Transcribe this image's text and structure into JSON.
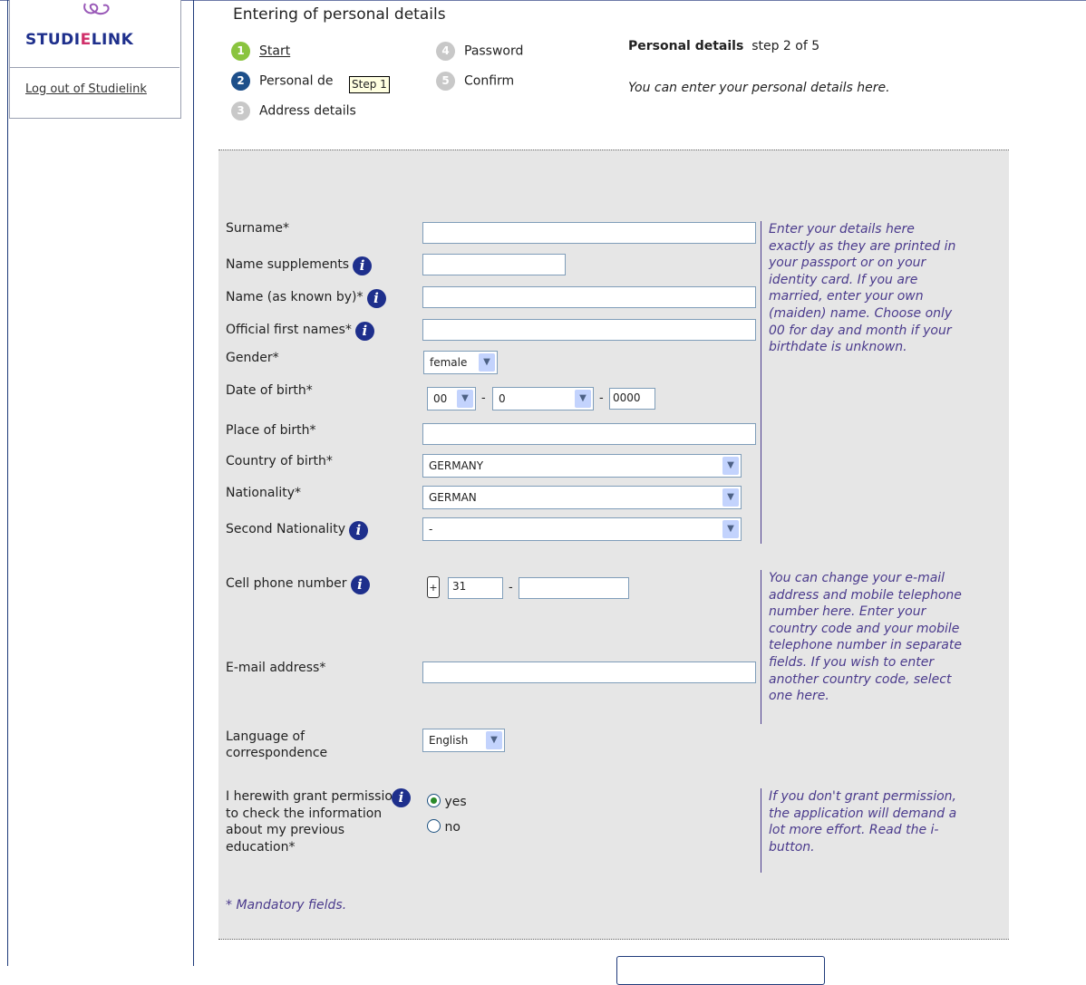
{
  "sidebar": {
    "logo": "STUDIELINK",
    "logout": "Log out of Studielink"
  },
  "header": {
    "title": "Entering of personal details",
    "steps": [
      {
        "num": "1",
        "label": "Start"
      },
      {
        "num": "2",
        "label": "Personal de"
      },
      {
        "num": "3",
        "label": "Address details"
      },
      {
        "num": "4",
        "label": "Password"
      },
      {
        "num": "5",
        "label": "Confirm"
      }
    ],
    "tooltip": "Step 1",
    "right_title_bold": "Personal details",
    "right_title_step": "step 2 of 5",
    "right_desc": "You can enter your personal details here."
  },
  "form": {
    "labels": {
      "surname": "Surname*",
      "name_supplements": "Name supplements",
      "known_by": "Name (as known by)*",
      "first_names": "Official first names*",
      "gender": "Gender*",
      "dob": "Date of birth*",
      "place_of_birth": "Place of birth*",
      "country_of_birth": "Country of birth*",
      "nationality": "Nationality*",
      "second_nationality": "Second Nationality",
      "cell_phone": "Cell phone number",
      "email": "E-mail address*",
      "language": "Language of correspondence",
      "permission": "I herewith grant permission to check the information about my previous education*"
    },
    "values": {
      "surname": "",
      "name_supplements": "",
      "known_by": "",
      "first_names": "",
      "gender": "female",
      "dob_day": "00",
      "dob_sep1": "-",
      "dob_month": "0",
      "dob_sep2": "-",
      "dob_year": "0000",
      "place_of_birth": "",
      "country_of_birth": "GERMANY",
      "nationality": "GERMAN",
      "second_nationality": "-",
      "phone_plus": "+",
      "phone_country": "31",
      "phone_sep": "-",
      "phone_number": "",
      "email": "",
      "language": "English",
      "permission_yes": "yes",
      "permission_no": "no"
    },
    "help": {
      "personal": "Enter your details here exactly as they are printed in your passport or on your identity card. If you are married, enter your own (maiden) name. Choose only 00 for day and month if your birthdate is unknown.",
      "contact": "You can change your e-mail address and mobile telephone number here. Enter your country code and your mobile telephone number in separate fields. If you wish to enter another country code, select one here.",
      "permission": "If you don't grant permission, the application will demand a lot more effort. Read the i-button."
    },
    "mandatory_note": "* Mandatory fields."
  }
}
